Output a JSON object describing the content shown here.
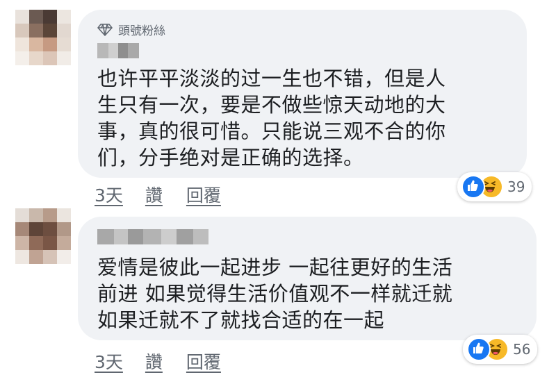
{
  "comments": [
    {
      "badge_label": "頭號粉絲",
      "text": "也许平平淡淡的过一生也不错，但是人\n生只有一次，要是不做些惊天动地的大\n事，真的很可惜。只能说三观不合的你\n们，分手绝对是正确的选择。",
      "time": "3天",
      "like_label": "讚",
      "reply_label": "回覆",
      "reaction_count": "39",
      "reaction_icons": [
        "like-icon",
        "haha-icon"
      ]
    },
    {
      "text": "爱情是彼此一起进步 一起往更好的生活\n前进 如果觉得生活价值观不一样就迁就\n如果迁就不了就找合适的在一起",
      "time": "3天",
      "like_label": "讚",
      "reply_label": "回覆",
      "reaction_count": "56",
      "reaction_icons": [
        "like-icon",
        "haha-icon"
      ]
    }
  ],
  "colors": {
    "bubble": "#f0f2f5",
    "like_blue": "#1877f2",
    "haha_yellow": "#f7b928",
    "meta_gray": "#606770"
  }
}
